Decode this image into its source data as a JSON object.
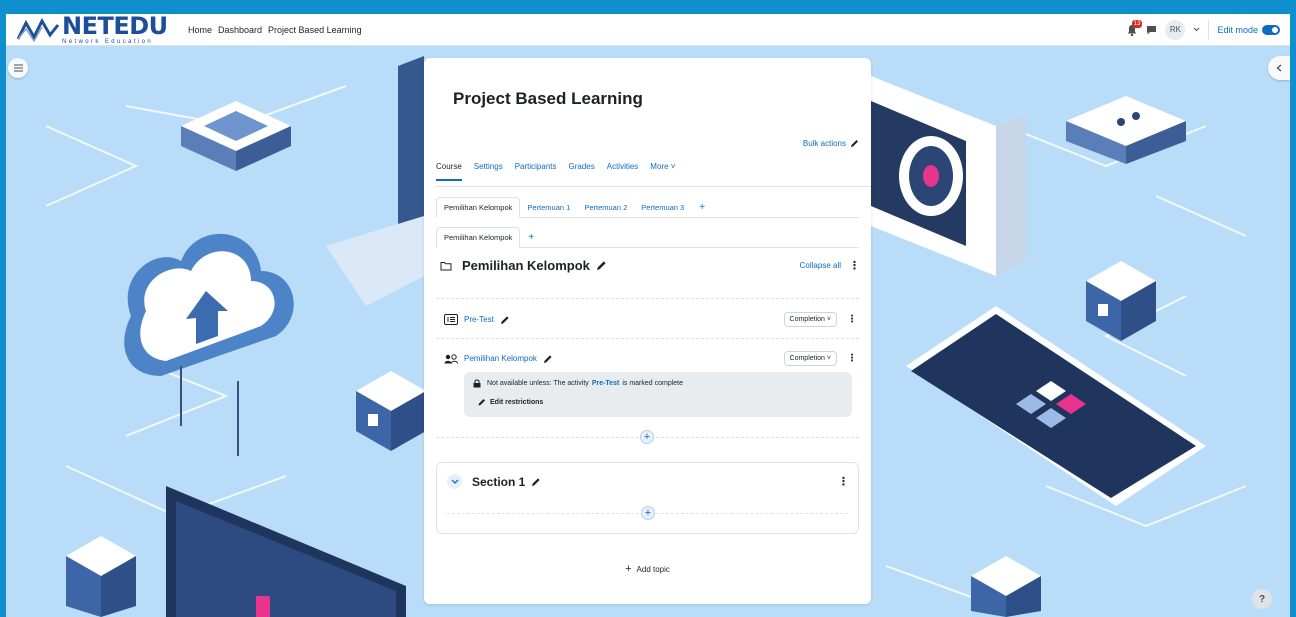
{
  "navbar": {
    "logo_text": "NETEDU",
    "logo_subtext": "Network Education",
    "links": [
      "Home",
      "Dashboard",
      "Project Based Learning"
    ],
    "notification_count": "13",
    "avatar_initials": "RK",
    "edit_mode_label": "Edit mode"
  },
  "course": {
    "title": "Project Based Learning",
    "bulk_actions": "Bulk actions",
    "secondary_nav": [
      "Course",
      "Settings",
      "Participants",
      "Grades",
      "Activities",
      "More"
    ],
    "section_tabs": [
      "Pemilihan Kelompok",
      "Pertemuan 1",
      "Pertemuan 2",
      "Pertemuan 3"
    ],
    "subsection_tabs": [
      "Pemilihan Kelompok"
    ],
    "add_tab": "+",
    "section_title": "Pemilihan Kelompok",
    "collapse_all": "Collapse all",
    "activities": [
      {
        "name": "Pre-Test",
        "completion": "Completion"
      },
      {
        "name": "Pemilihan Kelompok",
        "completion": "Completion"
      }
    ],
    "restriction": {
      "prefix": "Not available unless: The activity",
      "activity": "Pre-Test",
      "suffix": "is marked complete",
      "edit_label": "Edit restrictions"
    },
    "section1_title": "Section 1",
    "add_topic": "Add topic"
  },
  "colors": {
    "frame": "#0f8fce",
    "link": "#0f6cbf",
    "background": "#b7dcf7"
  }
}
